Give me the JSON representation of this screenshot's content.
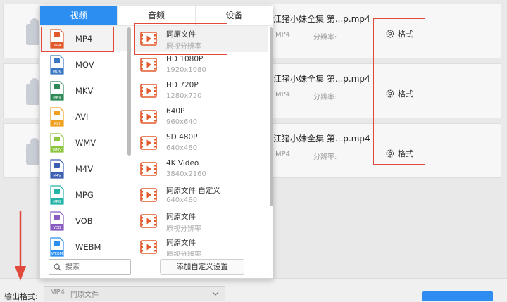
{
  "tabs": [
    {
      "label": "视频",
      "active": true
    },
    {
      "label": "音频",
      "active": false
    },
    {
      "label": "设备",
      "active": false
    }
  ],
  "formats": [
    {
      "label": "MP4",
      "icon_text": "MP4",
      "color": "#e25a2b",
      "selected": true
    },
    {
      "label": "MOV",
      "icon_text": "MOV",
      "color": "#3b78c4",
      "selected": false
    },
    {
      "label": "MKV",
      "icon_text": "MKV",
      "color": "#2e8b57",
      "selected": false
    },
    {
      "label": "AVI",
      "icon_text": "AVI",
      "color": "#f0a020",
      "selected": false
    },
    {
      "label": "WMV",
      "icon_text": "WMV",
      "color": "#8cc63f",
      "selected": false
    },
    {
      "label": "M4V",
      "icon_text": "M4V",
      "color": "#3c5fb0",
      "selected": false
    },
    {
      "label": "MPG",
      "icon_text": "MPG",
      "color": "#24b3a6",
      "selected": false
    },
    {
      "label": "VOB",
      "icon_text": "VOB",
      "color": "#8a5cc2",
      "selected": false
    },
    {
      "label": "WEBM",
      "icon_text": "WEBM",
      "color": "#2b8ef0",
      "selected": false
    }
  ],
  "presets": [
    {
      "name": "同原文件",
      "sub": "原视分辨率",
      "selected": true
    },
    {
      "name": "HD 1080P",
      "sub": "1920x1080",
      "selected": false
    },
    {
      "name": "HD 720P",
      "sub": "1280x720",
      "selected": false
    },
    {
      "name": "640P",
      "sub": "960x640",
      "selected": false
    },
    {
      "name": "SD 480P",
      "sub": "640x480",
      "selected": false
    },
    {
      "name": "4K Video",
      "sub": "3840x2160",
      "selected": false
    },
    {
      "name": "同原文件 自定义",
      "sub": "640x480",
      "selected": false
    },
    {
      "name": "同原文件",
      "sub": "原视分辨率",
      "selected": false
    },
    {
      "name": "同原文件",
      "sub": "原视分辨率",
      "selected": false
    }
  ],
  "search": {
    "placeholder": "搜索"
  },
  "add_custom_label": "添加自定义设置",
  "files": [
    {
      "name": "江猪小妹全集 第...p.mp4",
      "format": "MP4",
      "resolution_label": "分辨率:",
      "format_button": "格式"
    },
    {
      "name": "江猪小妹全集 第...p.mp4",
      "format": "MP4",
      "resolution_label": "分辨率:",
      "format_button": "格式"
    },
    {
      "name": "江猪小妹全集 第...p.mp4",
      "format": "MP4",
      "resolution_label": "分辨率:",
      "format_button": "格式"
    }
  ],
  "output": {
    "label": "输出格式:",
    "format": "MP4",
    "preset": "同原文件"
  },
  "colors": {
    "accent": "#2b8ef0",
    "highlight_red": "#e0493c",
    "preset_icon": "#e25a2b"
  }
}
